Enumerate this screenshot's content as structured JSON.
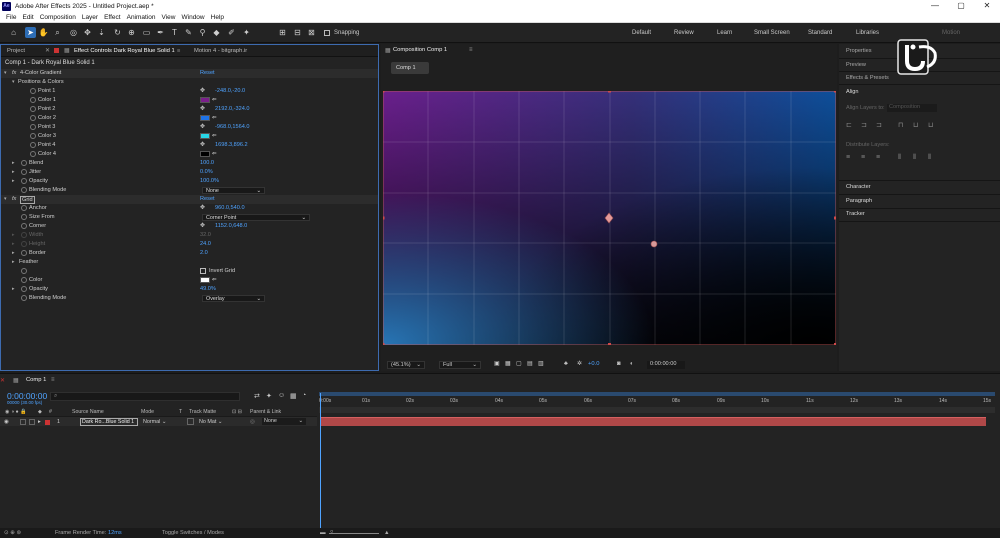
{
  "app": {
    "logo_text": "Ae",
    "title": "Adobe After Effects 2025 - Untitled Project.aep *"
  },
  "window_controls": {
    "minimize": "—",
    "maximize": "▢",
    "close": "✕"
  },
  "menu": [
    "File",
    "Edit",
    "Composition",
    "Layer",
    "Effect",
    "Animation",
    "View",
    "Window",
    "Help"
  ],
  "toolbar": {
    "snapping_label": "Snapping",
    "workspaces": [
      "Default",
      "Review",
      "Learn",
      "Small Screen",
      "Standard",
      "Libraries",
      "Motion"
    ],
    "tool_icons": [
      "home-icon",
      "selection-tool-icon",
      "hand-tool-icon",
      "zoom-tool-icon",
      "orbit-camera-icon",
      "pan-camera-icon",
      "dolly-camera-icon",
      "rotate-tool-icon",
      "anchor-point-icon",
      "rectangle-tool-icon",
      "pen-tool-icon",
      "type-tool-icon",
      "brush-tool-icon",
      "clone-stamp-icon",
      "eraser-icon",
      "roto-brush-icon",
      "puppet-pin-icon"
    ]
  },
  "left_panel": {
    "tabs": {
      "project": "Project",
      "effect_controls": "Effect Controls Dark Royal Blue Solid 1",
      "motion": "Motion 4 - bitgraph.ir"
    },
    "layer_label": "Comp 1 - Dark Royal Blue Solid 1",
    "gradient": {
      "name": "4-Color Gradient",
      "reset": "Reset",
      "positions_colors": "Positions & Colors",
      "point1_label": "Point 1",
      "point1_value": "-248.0,-20.0",
      "color1_label": "Color 1",
      "color1": "#7a1f8a",
      "point2_label": "Point 2",
      "point2_value": "2192.0,-324.0",
      "color2_label": "Color 2",
      "color2": "#1e73e8",
      "point3_label": "Point 3",
      "point3_value": "-968.0,1564.0",
      "color3_label": "Color 3",
      "color3": "#28d6e6",
      "point4_label": "Point 4",
      "point4_value": "1698.3,896.2",
      "color4_label": "Color 4",
      "color4": "#000000",
      "blend_label": "Blend",
      "blend_value": "100.0",
      "jitter_label": "Jitter",
      "jitter_value": "0.0%",
      "opacity_label": "Opacity",
      "opacity_value": "100.0%",
      "blending_mode_label": "Blending Mode",
      "blending_mode_value": "None"
    },
    "grid": {
      "name": "Grid",
      "reset": "Reset",
      "anchor_label": "Anchor",
      "anchor_value": "960.0,540.0",
      "size_from_label": "Size From",
      "size_from_value": "Corner Point",
      "corner_label": "Corner",
      "corner_value": "1152.0,648.0",
      "width_label": "Width",
      "width_value": "32.0",
      "height_label": "Height",
      "height_value": "24.0",
      "border_label": "Border",
      "border_value": "2.0",
      "feather_label": "Feather",
      "invert_label": "Invert Grid",
      "color_label": "Color",
      "color": "#ffffff",
      "opacity_label": "Opacity",
      "opacity_value": "49.0%",
      "blending_mode_label": "Blending Mode",
      "blending_mode_value": "Overlay"
    }
  },
  "comp_panel": {
    "tab": "Composition Comp 1",
    "sub_tab": "Comp 1",
    "zoom": "(45.1%)",
    "resolution": "Full",
    "exposure": "+0.0",
    "timecode": "0:00:00:00"
  },
  "right_panel": {
    "properties": "Properties",
    "preview": "Preview",
    "effects_presets": "Effects & Presets",
    "align": "Align",
    "align_layers_to": "Align Layers to:",
    "align_target": "Composition",
    "distribute_layers": "Distribute Layers:",
    "character": "Character",
    "paragraph": "Paragraph",
    "tracker": "Tracker"
  },
  "timeline": {
    "tab": "Comp 1",
    "timecode": "0:00:00:00",
    "timecode_sub": "00000 (30.00 fps)",
    "search_placeholder": "",
    "columns": {
      "source_name": "Source Name",
      "mode": "Mode",
      "t": "T",
      "track_matte": "Track Matte",
      "parent_link": "Parent & Link"
    },
    "layer": {
      "index": "1",
      "name": "Dark Ro...Blue Solid 1",
      "mode": "Normal",
      "matte": "No Mat",
      "parent": "None"
    },
    "ruler_ticks": [
      "0:00s",
      "01s",
      "02s",
      "03s",
      "04s",
      "05s",
      "06s",
      "07s",
      "08s",
      "09s",
      "10s",
      "11s",
      "12s",
      "13s",
      "14s",
      "15s"
    ]
  },
  "status": {
    "frame_render_label": "Frame Render Time:",
    "frame_render_value": "12ms",
    "toggle": "Toggle Switches / Modes"
  }
}
